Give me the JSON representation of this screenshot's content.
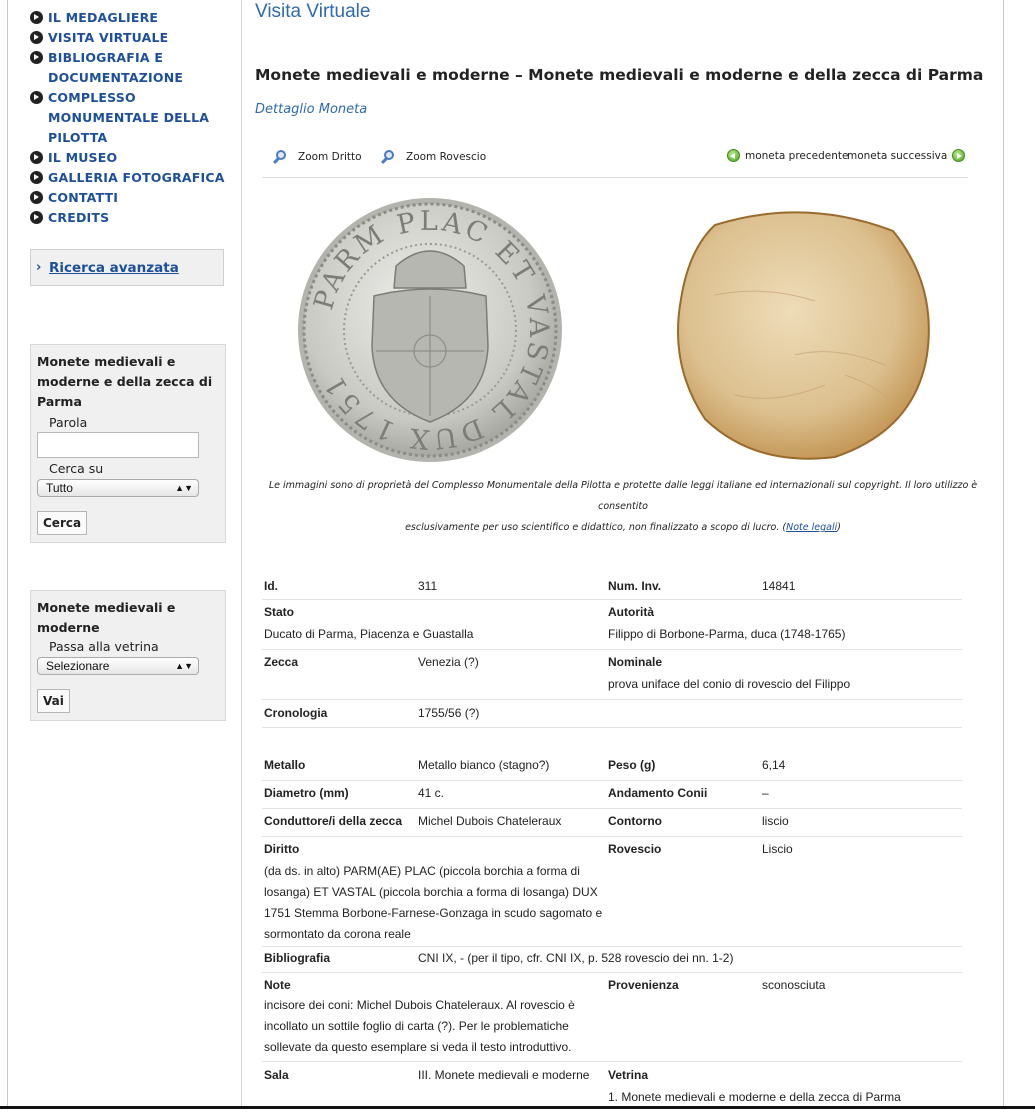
{
  "nav": [
    {
      "label": "IL MEDAGLIERE"
    },
    {
      "label": "VISITA VIRTUALE"
    },
    {
      "label": "BIBLIOGRAFIA E DOCUMENTAZIONE"
    },
    {
      "label": "COMPLESSO MONUMENTALE DELLA PILOTTA"
    },
    {
      "label": "IL MUSEO"
    },
    {
      "label": "GALLERIA FOTOGRAFICA"
    },
    {
      "label": "CONTATTI"
    },
    {
      "label": "CREDITS"
    }
  ],
  "advanced_search": {
    "label": "Ricerca avanzata"
  },
  "search_box": {
    "title": "Monete medievali e moderne e della zecca di Parma",
    "word_label": "Parola",
    "word_value": "",
    "search_on_label": "Cerca su",
    "search_on_selected": "Tutto",
    "button": "Cerca"
  },
  "vetrina_box": {
    "title": "Monete medievali e moderne",
    "label": "Passa alla vetrina",
    "selected": "Selezionare",
    "button": "Vai"
  },
  "main": {
    "heading": "Visita Virtuale",
    "collection_title": "Monete medievali e moderne – Monete medievali e moderne e della zecca di Parma",
    "subtitle": "Dettaglio Moneta"
  },
  "toolbar": {
    "zoom_front": "Zoom Dritto",
    "zoom_back": "Zoom Rovescio",
    "prev": "moneta precedente",
    "next": "moneta successiva"
  },
  "coin": {
    "obverse_legend": "PARM PLAC ET VASTAL DUX 1751",
    "obverse_color": "#c9c9c4",
    "reverse_color": "#d9b98a"
  },
  "copyright": {
    "text1": "Le immagini sono di proprietà del Complesso Monumentale della Pilotta e protette dalle leggi italiane ed internazionali sul copyright. Il loro utilizzo è consentito",
    "text2": "esclusivamente per uso scientifico e didattico, non finalizzato a scopo di lucro. (",
    "link": "Note legali",
    "text3": ")"
  },
  "details": {
    "id_label": "Id.",
    "id_value": "311",
    "inv_label": "Num. Inv.",
    "inv_value": "14841",
    "stato_label": "Stato",
    "stato_value": "Ducato di Parma, Piacenza e Guastalla",
    "autorita_label": "Autorità",
    "autorita_value": "Filippo di Borbone-Parma, duca (1748-1765)",
    "zecca_label": "Zecca",
    "zecca_value": "Venezia (?)",
    "nominale_label": "Nominale",
    "nominale_value": "prova uniface del conio di rovescio del Filippo",
    "cronologia_label": "Cronologia",
    "cronologia_value": "1755/56 (?)",
    "metallo_label": "Metallo",
    "metallo_value": "Metallo bianco (stagno?)",
    "peso_label": "Peso (g)",
    "peso_value": "6,14",
    "diametro_label": "Diametro (mm)",
    "diametro_value": "41 c.",
    "andamento_label": "Andamento Conii",
    "andamento_value": "–",
    "conduttore_label": "Conduttore/i della zecca",
    "conduttore_value": "Michel Dubois Chateleraux",
    "contorno_label": "Contorno",
    "contorno_value": "liscio",
    "diritto_label": "Diritto",
    "diritto_lines": [
      "(da ds. in alto) PARM(AE) PLAC (piccola borchia a forma di",
      "losanga) ET VASTAL (piccola borchia a forma di losanga) DUX",
      "1751 Stemma Borbone-Farnese-Gonzaga in scudo sagomato e",
      "sormontato da corona reale"
    ],
    "rovescio_label": "Rovescio",
    "rovescio_value": "Liscio",
    "bibliografia_label": "Bibliografia",
    "bibliografia_value": "CNI IX, - (per il tipo, cfr. CNI IX, p. 528 rovescio dei nn. 1-2)",
    "note_label": "Note",
    "note_lines": [
      "incisore dei coni: Michel Dubois Chateleraux. Al rovescio è",
      "incollato un sottile foglio di carta (?). Per le problematiche",
      "sollevate da questo esemplare si veda il testo introduttivo."
    ],
    "provenienza_label": "Provenienza",
    "provenienza_value": "sconosciuta",
    "sala_label": "Sala",
    "sala_value": "III. Monete medievali e moderne",
    "vetrina_label": "Vetrina",
    "vetrina_value": "1. Monete medievali e moderne e della zecca di Parma"
  }
}
